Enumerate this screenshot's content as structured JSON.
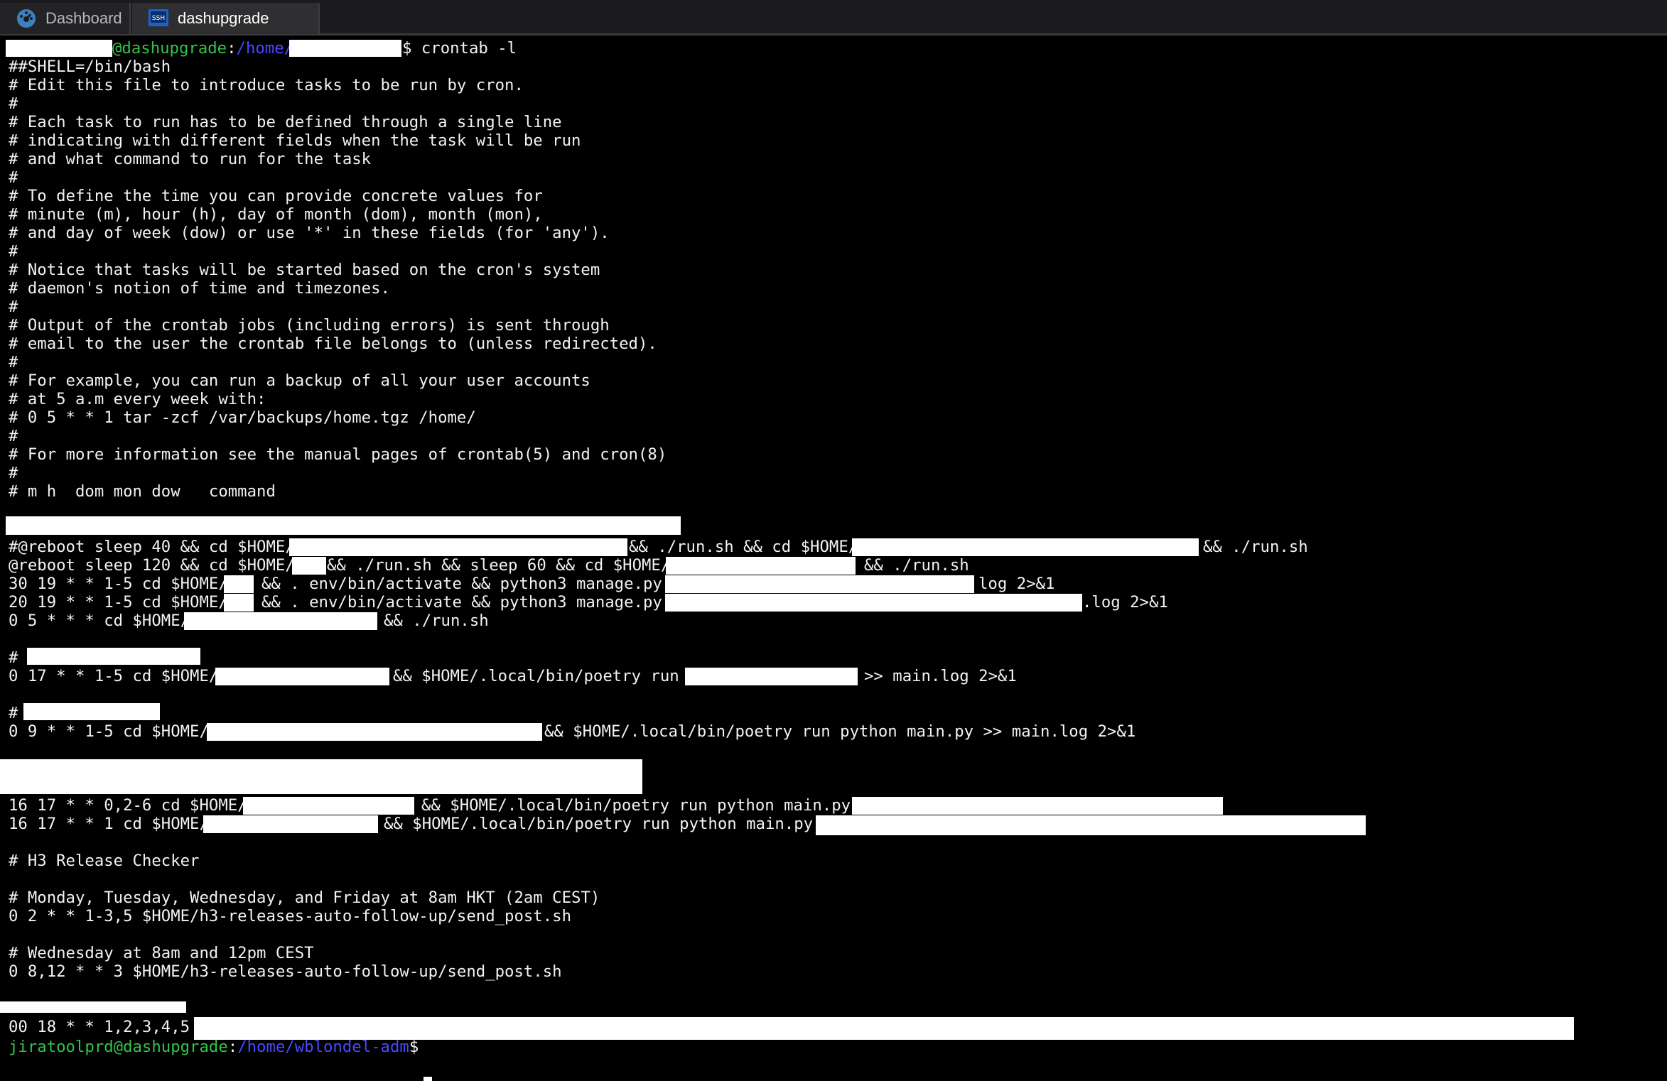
{
  "tabs": [
    {
      "label": "Dashboard",
      "icon": "dashboard-icon"
    },
    {
      "label": "dashupgrade",
      "icon": "ssh-terminal-icon"
    }
  ],
  "prompt": {
    "host": "@dashupgrade",
    "path": "/home/",
    "command": "$ crontab -l"
  },
  "lines": {
    "l1": "##SHELL=/bin/bash",
    "l2": "# Edit this file to introduce tasks to be run by cron.",
    "l3": "#",
    "l4": "# Each task to run has to be defined through a single line",
    "l5": "# indicating with different fields when the task will be run",
    "l6": "# and what command to run for the task",
    "l7": "#",
    "l8": "# To define the time you can provide concrete values for",
    "l9": "# minute (m), hour (h), day of month (dom), month (mon),",
    "l10": "# and day of week (dow) or use '*' in these fields (for 'any').",
    "l11": "#",
    "l12": "# Notice that tasks will be started based on the cron's system",
    "l13": "# daemon's notion of time and timezones.",
    "l14": "#",
    "l15": "# Output of the crontab jobs (including errors) is sent through",
    "l16": "# email to the user the crontab file belongs to (unless redirected).",
    "l17": "#",
    "l18": "# For example, you can run a backup of all your user accounts",
    "l19": "# at 5 a.m every week with:",
    "l20": "# 0 5 * * 1 tar -zcf /var/backups/home.tgz /home/",
    "l21": "#",
    "l22": "# For more information see the manual pages of crontab(5) and cron(8)",
    "l23": "#",
    "l24": "# m h  dom mon dow   command"
  },
  "jobs": {
    "j1a": "#@reboot sleep 40 && cd $HOME/",
    "j1b": "&& ./run.sh && cd $HOME/",
    "j1c": "&& ./run.sh",
    "j2a": "@reboot sleep 120 && cd $HOME/",
    "j2b": "&& ./run.sh && sleep 60 && cd $HOME/",
    "j2c": "&& ./run.sh",
    "j3a": "30 19 * * 1-5 cd $HOME/",
    "j3b": "&& . env/bin/activate && python3 manage.py",
    "j3c": "log 2>&1",
    "j4a": "20 19 * * 1-5 cd $HOME/",
    "j4b": "&& . env/bin/activate && python3 manage.py",
    "j4c": ".log 2>&1",
    "j5a": "0 5 * * * cd $HOME/",
    "j5b": "&& ./run.sh",
    "c1": "#",
    "j6a": "0 17 * * 1-5 cd $HOME/",
    "j6b": "&& $HOME/.local/bin/poetry run",
    "j6c": ">> main.log 2>&1",
    "c2": "#",
    "j7a": "0 9 * * 1-5 cd $HOME/",
    "j7b": "&& $HOME/.local/bin/poetry run python main.py >> main.log 2>&1",
    "j8a": "16 17 * * 0,2-6 cd $HOME/",
    "j8b": "&& $HOME/.local/bin/poetry run python main.py",
    "j9a": "16 17 * * 1 cd $HOME/",
    "j9b": "&& $HOME/.local/bin/poetry run python main.py",
    "h3": "# H3 Release Checker",
    "h3c1": "# Monday, Tuesday, Wednesday, and Friday at 8am HKT (2am CEST)",
    "h3j1": "0 2 * * 1-3,5 $HOME/h3-releases-auto-follow-up/send_post.sh",
    "h3c2": "# Wednesday at 8am and 12pm CEST",
    "h3j2": "0 8,12 * * 3 $HOME/h3-releases-auto-follow-up/send_post.sh",
    "j10": "00 18 * * 1,2,3,4,5"
  },
  "final_prompt": {
    "user_host": "jiratoolprd@dashupgrade",
    "sep": ":",
    "path": "/home/wblondel-adm",
    "dollar": "$ "
  }
}
